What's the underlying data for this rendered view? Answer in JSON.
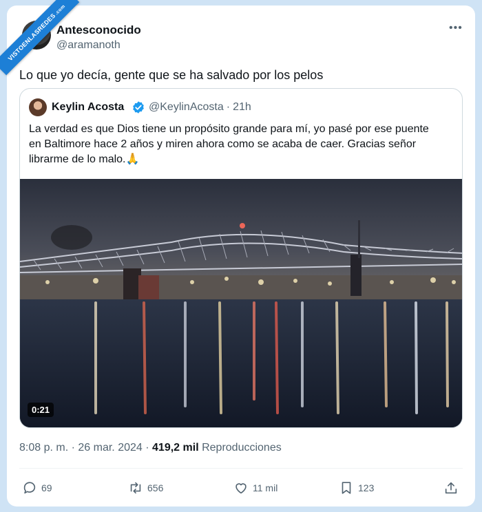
{
  "watermark": {
    "text": "VISTOENLASREDES",
    "suffix": ".com"
  },
  "author": {
    "display_name": "Antesconocido",
    "handle": "@aramanoth"
  },
  "more_label": "•••",
  "tweet_text": "Lo que yo decía, gente que se ha salvado por los pelos",
  "quoted": {
    "display_name": "Keylin Acosta",
    "handle": "@KeylinAcosta",
    "separator": "·",
    "time": "21h",
    "text": "La verdad es que Dios tiene un propósito grande para mí, yo pasé por ese puente en Baltimore hace 2 años y miren ahora como se acaba de caer. Gracias señor librarme de lo malo.🙏",
    "video_duration": "0:21"
  },
  "meta": {
    "time": "8:08 p. m.",
    "separator": "·",
    "date": "26 mar. 2024",
    "views_count": "419,2 mil",
    "views_label": "Reproducciones"
  },
  "actions": {
    "replies": "69",
    "reposts": "656",
    "likes": "11 mil",
    "bookmarks": "123"
  },
  "colors": {
    "accent": "#1d9bf0",
    "text_primary": "#0f1419",
    "text_secondary": "#536471",
    "background": "#cfe3f5"
  }
}
